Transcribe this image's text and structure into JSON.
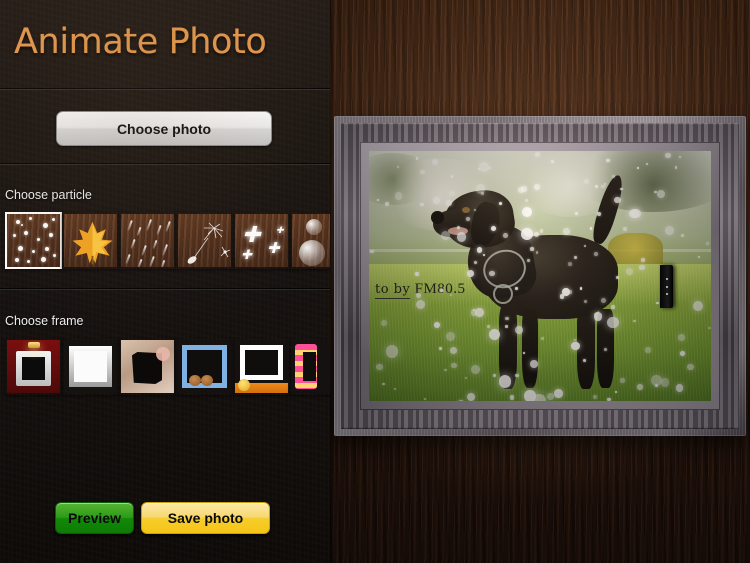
{
  "app": {
    "title": "Animate Photo",
    "title_color": "#e79a4e"
  },
  "photo_section": {
    "choose_photo_label": "Choose photo"
  },
  "particle_section": {
    "label": "Choose particle",
    "selected_index": 0,
    "items": [
      {
        "name": "bubbles-particle",
        "icon": "dots-icon"
      },
      {
        "name": "maple-leaf-particle",
        "icon": "leaf-icon"
      },
      {
        "name": "rain-particle",
        "icon": "rain-icon"
      },
      {
        "name": "dandelion-particle",
        "icon": "dandelion-icon"
      },
      {
        "name": "sparkle-particle",
        "icon": "sparkle-icon"
      },
      {
        "name": "bubble-large-particle",
        "icon": "bubble-icon"
      }
    ]
  },
  "frame_section": {
    "label": "Choose frame",
    "selected_index": -1,
    "items": [
      {
        "name": "red-velvet-frame",
        "icon": "frame-red-icon"
      },
      {
        "name": "white-bevel-frame",
        "icon": "frame-white-icon"
      },
      {
        "name": "stone-collage-frame",
        "icon": "frame-stone-icon"
      },
      {
        "name": "blue-cookie-frame",
        "icon": "frame-blue-icon"
      },
      {
        "name": "polaroid-orange-frame",
        "icon": "frame-polaroid-icon"
      },
      {
        "name": "pink-scallop-frame",
        "icon": "frame-pink-icon"
      }
    ]
  },
  "actions": {
    "preview_label": "Preview",
    "preview_color": "#1d9a12",
    "save_label": "Save photo",
    "save_color": "#f6cd2c"
  },
  "preview": {
    "frame_style": "ornate-silver-carved",
    "photo_subject": "black labrador dog standing on grass",
    "watermark_cursive": "to by",
    "watermark_text": "FM80.5",
    "handle": "drag-handle-three-dots"
  }
}
